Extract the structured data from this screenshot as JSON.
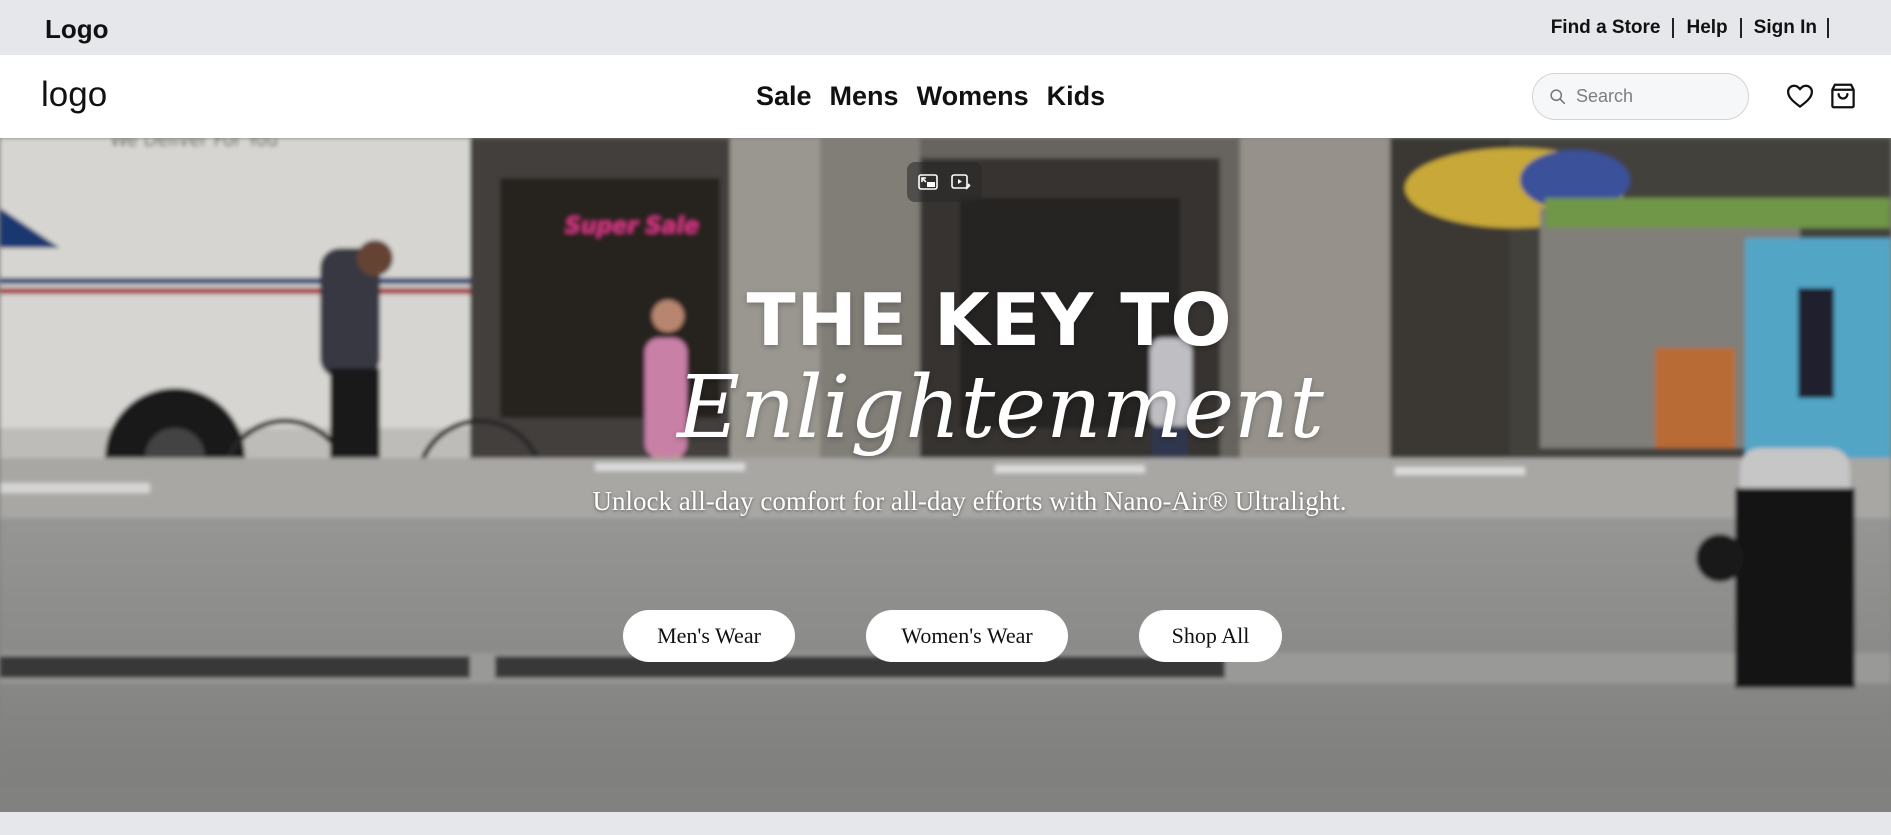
{
  "utility_bar": {
    "brand": "Logo",
    "links": [
      "Find a Store",
      "Help",
      "Sign In"
    ]
  },
  "header": {
    "brand": "logo",
    "nav": [
      "Sale",
      "Mens",
      "Womens",
      "Kids"
    ],
    "search_placeholder": "Search",
    "icons": [
      "search-icon",
      "heart-icon",
      "shopping-bag-icon"
    ]
  },
  "hero": {
    "headline_line1": "THE KEY TO",
    "headline_line2": "Enlightenment",
    "subhead": "Unlock all-day comfort for all-day efforts with Nano-Air® Ultralight.",
    "buttons": [
      "Men's Wear",
      "Women's Wear",
      "Shop All"
    ],
    "video_controls": [
      "exit-picture-in-picture-icon",
      "video-effects-icon"
    ],
    "scene_text": {
      "store_sign": "Super Sale",
      "truck_sign": "We Deliver For You"
    }
  },
  "colors": {
    "utility_bg": "#e6e7eb",
    "header_bg": "#ffffff",
    "text": "#111111",
    "hero_text": "#ffffff",
    "button_bg": "#ffffff"
  }
}
